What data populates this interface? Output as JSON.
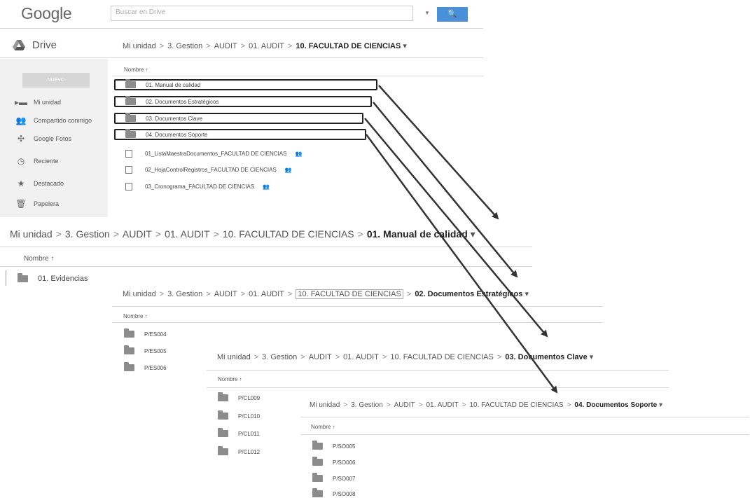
{
  "top": {
    "logo": "Google",
    "search_placeholder": "Buscar en Drive",
    "search_button": "🔍",
    "app_name": "Drive",
    "new_button": "NUEVO"
  },
  "sidebar": {
    "items": [
      {
        "label": "Mi unidad",
        "icon": "folder-icon"
      },
      {
        "label": "Compartido conmigo",
        "icon": "people-icon"
      },
      {
        "label": "Google Fotos",
        "icon": "pinwheel-icon"
      },
      {
        "label": "Reciente",
        "icon": "clock-icon"
      },
      {
        "label": "Destacado",
        "icon": "star-icon"
      },
      {
        "label": "Papelera",
        "icon": "trash-icon"
      }
    ]
  },
  "breadcrumbs": {
    "base": [
      "Mi unidad",
      "3. Gestion",
      "AUDIT",
      "01. AUDIT"
    ],
    "faculty": "10. FACULTAD DE CIENCIAS",
    "manual": "01. Manual de calidad",
    "estrategicos": "02. Documentos Estratégicos",
    "clave": "03. Documentos Clave",
    "soporte": "04. Documentos Soporte"
  },
  "column_header": "Nombre ↑",
  "main_list": {
    "folders": [
      "01. Manual de calidad",
      "02. Documentos Estratégicos",
      "03. Documentos Clave",
      "04. Documentos Soporte"
    ],
    "files": [
      "01_ListaMaestraDocumentos_FACULTAD DE CIENCIAS",
      "02_HojaControlRegistros_FACULTAD DE CIENCIAS",
      "03_Cronograma_FACULTAD DE CIENCIAS"
    ],
    "shared_mark": "👥"
  },
  "panel_manual": {
    "items": [
      "01. Evidencias"
    ]
  },
  "panel_estrategicos": {
    "items": [
      "P/ES004",
      "P/ES005",
      "P/ES006"
    ]
  },
  "panel_clave": {
    "items": [
      "P/CL009",
      "P/CL010",
      "P/CL011",
      "P/CL012"
    ]
  },
  "panel_soporte": {
    "items": [
      "P/SO005",
      "P/SO006",
      "P/SO007",
      "P/SO008"
    ]
  }
}
